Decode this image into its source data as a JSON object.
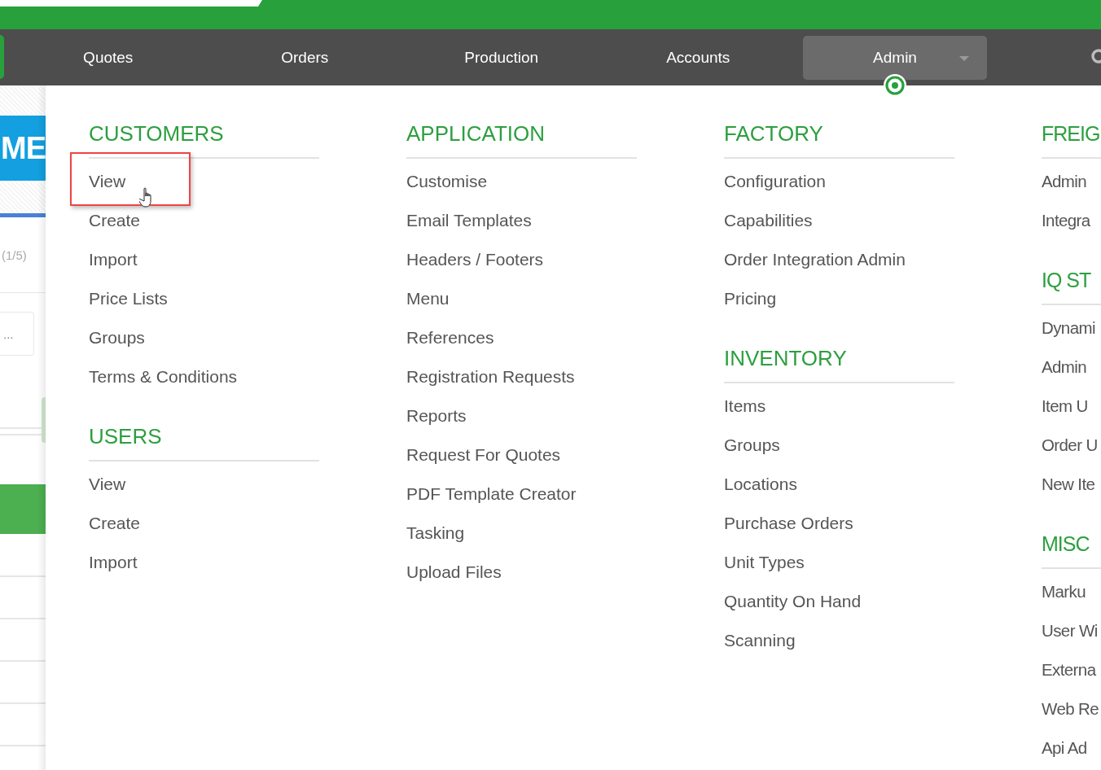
{
  "nav": {
    "items": [
      {
        "label": "Quotes",
        "selected": false,
        "kind": "link"
      },
      {
        "label": "Orders",
        "selected": false,
        "kind": "link"
      },
      {
        "label": "Production",
        "selected": false,
        "kind": "link"
      },
      {
        "label": "Accounts",
        "selected": false,
        "kind": "link"
      },
      {
        "label": "Admin",
        "selected": true,
        "kind": "dropdown"
      }
    ]
  },
  "background_page": {
    "banner_text": "ME",
    "pager": "(1/5)",
    "more": "..."
  },
  "menu": {
    "columns": [
      {
        "groups": [
          {
            "title": "CUSTOMERS",
            "items": [
              {
                "label": "View",
                "highlighted": true
              },
              {
                "label": "Create",
                "highlighted": false
              },
              {
                "label": "Import",
                "highlighted": false
              },
              {
                "label": "Price Lists",
                "highlighted": false
              },
              {
                "label": "Groups",
                "highlighted": false
              },
              {
                "label": "Terms & Conditions",
                "highlighted": false
              }
            ]
          },
          {
            "title": "USERS",
            "items": [
              {
                "label": "View",
                "highlighted": false
              },
              {
                "label": "Create",
                "highlighted": false
              },
              {
                "label": "Import",
                "highlighted": false
              }
            ]
          }
        ]
      },
      {
        "groups": [
          {
            "title": "APPLICATION",
            "items": [
              {
                "label": "Customise",
                "highlighted": false
              },
              {
                "label": "Email Templates",
                "highlighted": false
              },
              {
                "label": "Headers / Footers",
                "highlighted": false
              },
              {
                "label": "Menu",
                "highlighted": false
              },
              {
                "label": "References",
                "highlighted": false
              },
              {
                "label": "Registration Requests",
                "highlighted": false
              },
              {
                "label": "Reports",
                "highlighted": false
              },
              {
                "label": "Request For Quotes",
                "highlighted": false
              },
              {
                "label": "PDF Template Creator",
                "highlighted": false
              },
              {
                "label": "Tasking",
                "highlighted": false
              },
              {
                "label": "Upload Files",
                "highlighted": false
              }
            ]
          }
        ]
      },
      {
        "groups": [
          {
            "title": "FACTORY",
            "items": [
              {
                "label": "Configuration",
                "highlighted": false
              },
              {
                "label": "Capabilities",
                "highlighted": false
              },
              {
                "label": "Order Integration Admin",
                "highlighted": false
              },
              {
                "label": "Pricing",
                "highlighted": false
              }
            ]
          },
          {
            "title": "INVENTORY",
            "items": [
              {
                "label": "Items",
                "highlighted": false
              },
              {
                "label": "Groups",
                "highlighted": false
              },
              {
                "label": "Locations",
                "highlighted": false
              },
              {
                "label": "Purchase Orders",
                "highlighted": false
              },
              {
                "label": "Unit Types",
                "highlighted": false
              },
              {
                "label": "Quantity On Hand",
                "highlighted": false
              },
              {
                "label": "Scanning",
                "highlighted": false
              }
            ]
          }
        ]
      },
      {
        "groups": [
          {
            "title": "FREIG",
            "items": [
              {
                "label": "Admin",
                "highlighted": false
              },
              {
                "label": "Integra",
                "highlighted": false
              }
            ]
          },
          {
            "title": "IQ ST",
            "items": [
              {
                "label": "Dynami",
                "highlighted": false
              },
              {
                "label": "Admin",
                "highlighted": false
              },
              {
                "label": "Item U",
                "highlighted": false
              },
              {
                "label": "Order U",
                "highlighted": false
              },
              {
                "label": "New Ite",
                "highlighted": false
              }
            ]
          },
          {
            "title": "MISC",
            "items": [
              {
                "label": "Marku",
                "highlighted": false
              },
              {
                "label": "User Wi",
                "highlighted": false
              },
              {
                "label": "Externa",
                "highlighted": false
              },
              {
                "label": "Web Re",
                "highlighted": false
              },
              {
                "label": "Api Ad",
                "highlighted": false
              }
            ]
          }
        ]
      }
    ]
  }
}
